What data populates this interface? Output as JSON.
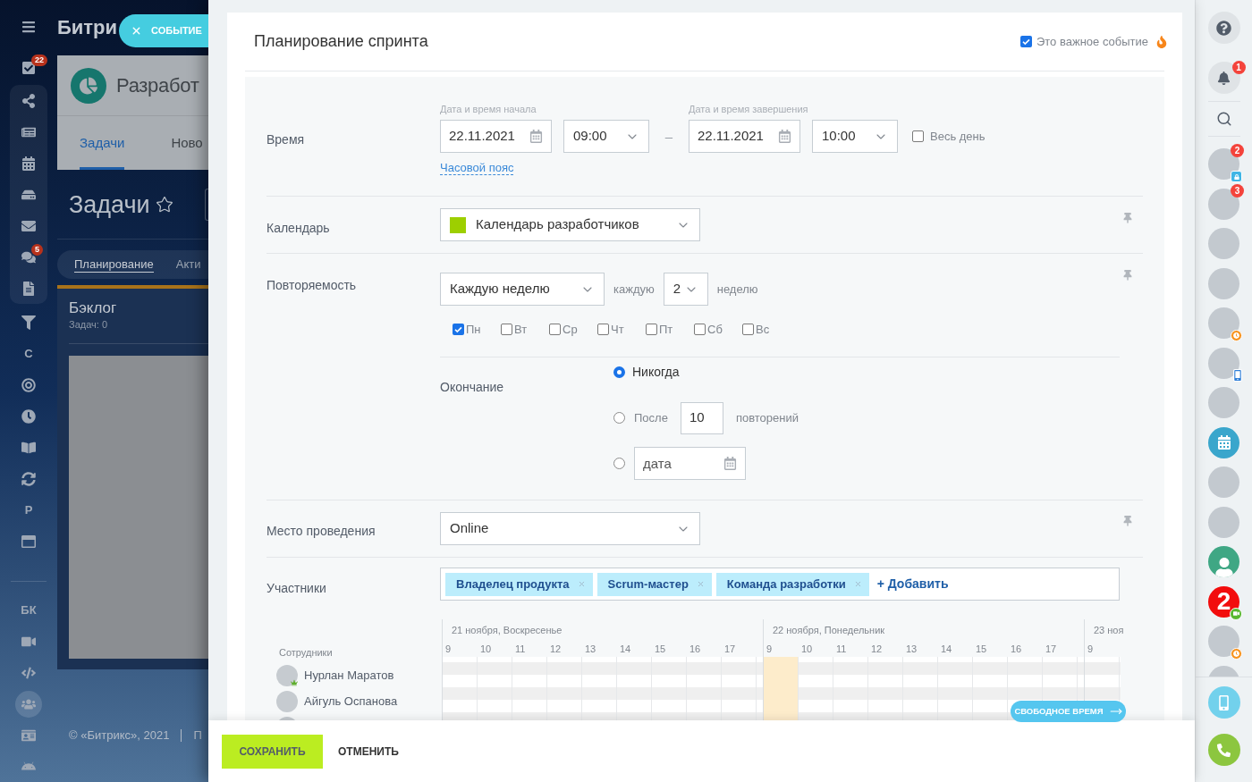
{
  "app": {
    "nav": [
      {
        "kind": "icon"
      },
      {
        "kind": "icon",
        "badge": "22"
      },
      {
        "kind": "icon"
      },
      {
        "kind": "icon"
      },
      {
        "kind": "icon"
      },
      {
        "kind": "icon"
      },
      {
        "kind": "icon"
      },
      {
        "kind": "icon",
        "badge": "5"
      },
      {
        "kind": "icon"
      },
      {
        "kind": "icon"
      },
      {
        "kind": "letter",
        "label": "С"
      },
      {
        "kind": "icon"
      },
      {
        "kind": "icon"
      },
      {
        "kind": "icon"
      },
      {
        "kind": "icon"
      },
      {
        "kind": "letter",
        "label": "Р"
      },
      {
        "kind": "icon"
      },
      {
        "kind": "letter",
        "label": "БК"
      },
      {
        "kind": "icon"
      },
      {
        "kind": "icon"
      },
      {
        "kind": "icon"
      },
      {
        "kind": "icon"
      },
      {
        "kind": "icon"
      }
    ],
    "brand": "Битри",
    "project": "Разработ",
    "project_tabs": [
      {
        "label": "Задачи",
        "selected": true
      },
      {
        "label": "Ново",
        "selected": false
      }
    ],
    "page_title": "Задачи",
    "view_tabs": [
      {
        "label": "Планирование",
        "selected": true
      },
      {
        "label": "Акти",
        "selected": false
      }
    ],
    "backlog": {
      "title": "Бэклог",
      "count": "Задач: 0"
    },
    "footer": {
      "copyright": "© «Битрикс», 2021",
      "link": "П"
    }
  },
  "event_tab": {
    "label": "СОБЫТИЕ"
  },
  "form": {
    "title": "Планирование спринта",
    "important": {
      "label": "Это важное событие",
      "checked": true
    },
    "time": {
      "label": "Время",
      "start": {
        "caption": "Дата и время начала",
        "date": "22.11.2021",
        "time": "09:00"
      },
      "separator": "–",
      "end": {
        "caption": "Дата и время завершения",
        "date": "22.11.2021",
        "time": "10:00"
      },
      "all_day": {
        "label": "Весь день",
        "checked": false
      },
      "timezone_link": "Часовой пояс"
    },
    "calendar": {
      "label": "Календарь",
      "value": "Календарь разработчиков"
    },
    "repeat": {
      "label": "Повторяемость",
      "frequency": "Каждую неделю",
      "every": "каждую",
      "interval": "2",
      "unit": "неделю",
      "days": [
        {
          "label": "Пн",
          "checked": true
        },
        {
          "label": "Вт",
          "checked": false
        },
        {
          "label": "Ср",
          "checked": false
        },
        {
          "label": "Чт",
          "checked": false
        },
        {
          "label": "Пт",
          "checked": false
        },
        {
          "label": "Сб",
          "checked": false
        },
        {
          "label": "Вс",
          "checked": false
        }
      ],
      "ending": {
        "label": "Окончание",
        "options": [
          {
            "kind": "never",
            "label": "Никогда",
            "selected": true
          },
          {
            "kind": "count",
            "label": "После",
            "value": "10",
            "suffix": "повторений",
            "selected": false
          },
          {
            "kind": "date",
            "placeholder": "дата",
            "selected": false
          }
        ]
      }
    },
    "location": {
      "label": "Место проведения",
      "value": "Online"
    },
    "attendees": {
      "label": "Участники",
      "tags": [
        "Владелец продукта",
        "Scrum-мастер",
        "Команда разработки"
      ],
      "add_link": "+ Добавить"
    }
  },
  "planner": {
    "employees_label": "Сотрудники",
    "employees": [
      {
        "kind": "host",
        "name": "Нурлан Маратов"
      },
      {
        "kind": "member",
        "name": "Айгуль Оспанова"
      },
      {
        "kind": "clipped"
      }
    ],
    "days": [
      {
        "label": "21 ноября, Воскресенье",
        "hours": [
          {
            "label": "9",
            "selected": false
          },
          {
            "label": "10",
            "selected": false
          },
          {
            "label": "11",
            "selected": false
          },
          {
            "label": "12",
            "selected": false
          },
          {
            "label": "13",
            "selected": false
          },
          {
            "label": "14",
            "selected": false
          },
          {
            "label": "15",
            "selected": false
          },
          {
            "label": "16",
            "selected": false
          },
          {
            "label": "17",
            "selected": false
          }
        ]
      },
      {
        "label": "22 ноября, Понедельник",
        "hours": [
          {
            "label": "9",
            "selected": true
          },
          {
            "label": "10",
            "selected": false
          },
          {
            "label": "11",
            "selected": false
          },
          {
            "label": "12",
            "selected": false
          },
          {
            "label": "13",
            "selected": false
          },
          {
            "label": "14",
            "selected": false
          },
          {
            "label": "15",
            "selected": false
          },
          {
            "label": "16",
            "selected": false
          },
          {
            "label": "17",
            "selected": false
          }
        ]
      },
      {
        "label": "23 ноя",
        "hours": [
          {
            "label": "9",
            "selected": false
          }
        ]
      }
    ],
    "free_time_button": "СВОБОДНОЕ ВРЕМЯ"
  },
  "actions": {
    "save": "СОХРАНИТЬ",
    "cancel": "ОТМЕНИТЬ"
  },
  "right_bar": {
    "notifications": "1",
    "contacts": [
      {
        "kind": "person",
        "badge": "2",
        "status": {
          "kind": "lock"
        }
      },
      {
        "kind": "person",
        "badge": "3"
      },
      {
        "kind": "person"
      },
      {
        "kind": "person"
      },
      {
        "kind": "person",
        "status": {
          "kind": "clock"
        }
      },
      {
        "kind": "person",
        "status": {
          "kind": "mobile"
        }
      },
      {
        "kind": "person"
      },
      {
        "kind": "calendar"
      },
      {
        "kind": "person"
      },
      {
        "kind": "person"
      },
      {
        "kind": "user"
      },
      {
        "kind": "number",
        "label": "2",
        "status": {
          "kind": "video"
        }
      },
      {
        "kind": "person",
        "status": {
          "kind": "clock"
        }
      },
      {
        "kind": "clipped"
      }
    ]
  }
}
